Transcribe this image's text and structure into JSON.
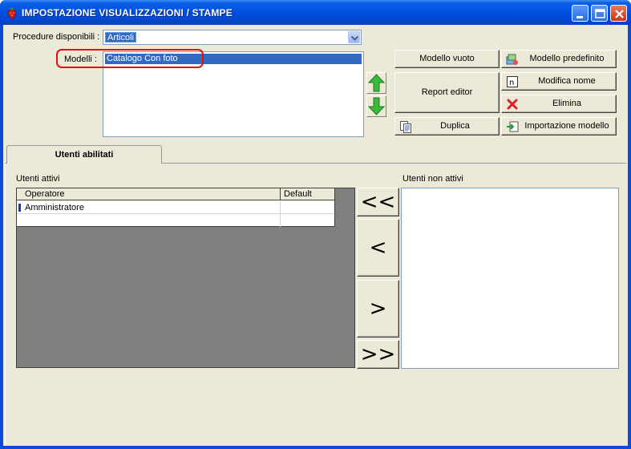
{
  "window": {
    "title": "IMPOSTAZIONE VISUALIZZAZIONI / STAMPE",
    "icons": {
      "app": "strawberry-icon",
      "minimize": "minimize-icon",
      "maximize": "maximize-icon",
      "close": "close-icon"
    }
  },
  "procedure": {
    "label": "Procedure disponibili :",
    "selected": "Articoli"
  },
  "modelli": {
    "label": "Modelli :",
    "items": [
      "Catalogo Con foto"
    ]
  },
  "buttons": {
    "modello_vuoto": "Modello vuoto",
    "modello_predefinito": "Modello predefinito",
    "report_editor": "Report editor",
    "modifica_nome": "Modifica nome",
    "elimina": "Elimina",
    "duplica": "Duplica",
    "importazione_modello": "Importazione modello"
  },
  "tabs": [
    {
      "label": "Utenti abilitati",
      "active": true
    }
  ],
  "utenti": {
    "attivi_label": "Utenti attivi",
    "non_attivi_label": "Utenti non attivi",
    "columns": [
      "Operatore",
      "Default"
    ],
    "rows": [
      {
        "operatore": "Amministratore",
        "default": ""
      }
    ],
    "move_all_left": "<<",
    "move_left": "<",
    "move_right": ">",
    "move_all_right": ">>"
  },
  "colors": {
    "titlebar": "#0050e0",
    "selection": "#316ac5",
    "highlight_ring": "#e01010",
    "arrow_green": "#3cb83c"
  }
}
